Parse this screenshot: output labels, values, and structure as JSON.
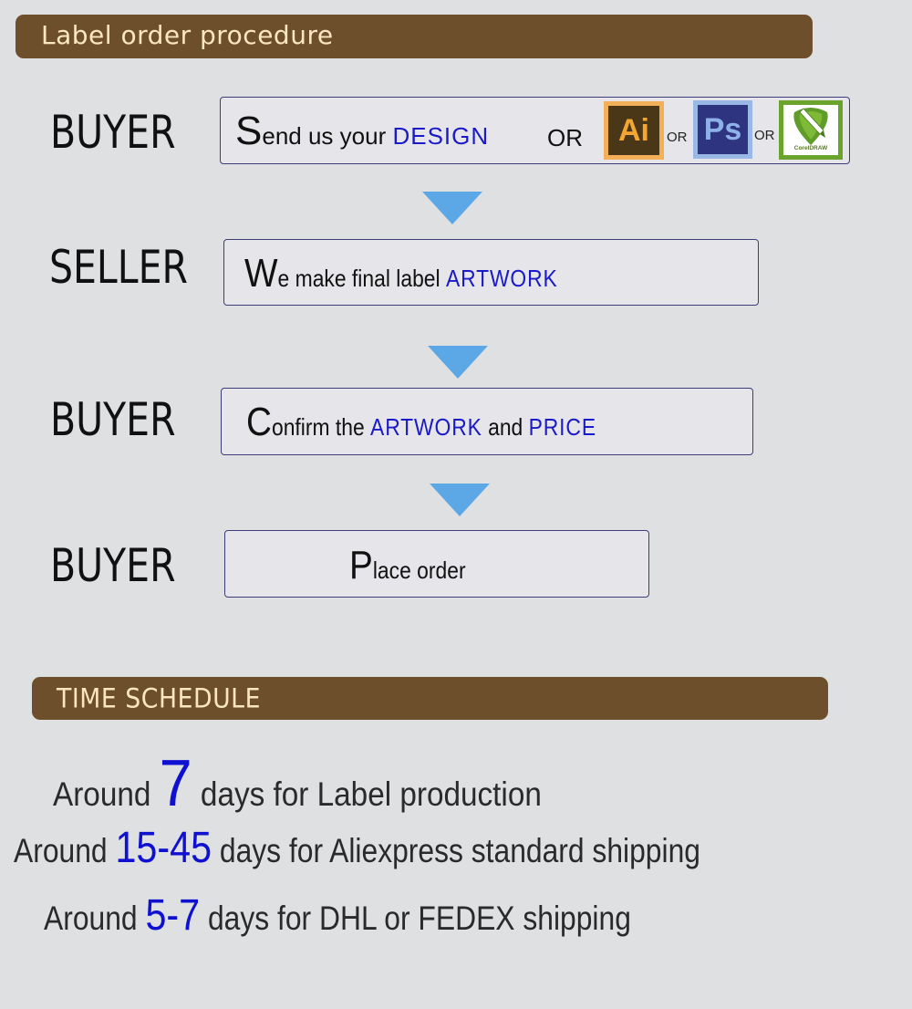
{
  "procedure_banner": {
    "title": "Label order procedure"
  },
  "steps": [
    {
      "role": "BUYER",
      "initial": "S",
      "parts": [
        {
          "text": "end us your ",
          "emphasis": false
        },
        {
          "text": "DESIGN",
          "emphasis": true
        },
        {
          "text": "OR",
          "emphasis": false
        }
      ],
      "software": [
        {
          "name": "adobe-illustrator",
          "label": "Ai"
        },
        {
          "separator": "OR"
        },
        {
          "name": "adobe-photoshop",
          "label": "Ps"
        },
        {
          "separator": "OR"
        },
        {
          "name": "coreldraw",
          "label": "CorelDRAW"
        }
      ]
    },
    {
      "role": "SELLER",
      "initial": "W",
      "parts": [
        {
          "text": "e make final label ",
          "emphasis": false
        },
        {
          "text": "ARTWORK",
          "emphasis": true
        }
      ]
    },
    {
      "role": "BUYER",
      "initial": "C",
      "parts": [
        {
          "text": "onfirm the ",
          "emphasis": false
        },
        {
          "text": "ARTWORK",
          "emphasis": true
        },
        {
          "text": " and ",
          "emphasis": false
        },
        {
          "text": "PRICE",
          "emphasis": true
        }
      ]
    },
    {
      "role": "BUYER",
      "initial": "P",
      "parts": [
        {
          "text": "lace order",
          "emphasis": false
        }
      ]
    }
  ],
  "arrows": [
    "arrow-down-icon",
    "arrow-down-icon",
    "arrow-down-icon"
  ],
  "schedule_banner": {
    "title": "TIME  SCHEDULE"
  },
  "schedule": [
    {
      "prefix": "Around ",
      "value": "7",
      "suffix": " days for Label production"
    },
    {
      "prefix": "Around ",
      "value": "15-45",
      "suffix": " days for Aliexpress standard shipping"
    },
    {
      "prefix": "Around ",
      "value": "5-7",
      "suffix": " days for DHL or FEDEX shipping"
    }
  ],
  "colors": {
    "banner_bg": "#6e4f2b",
    "banner_text": "#fbe6c2",
    "emphasis_blue": "#1a1ac8",
    "arrow_blue": "#5ca8e6",
    "page_bg": "#dfe0e2"
  }
}
